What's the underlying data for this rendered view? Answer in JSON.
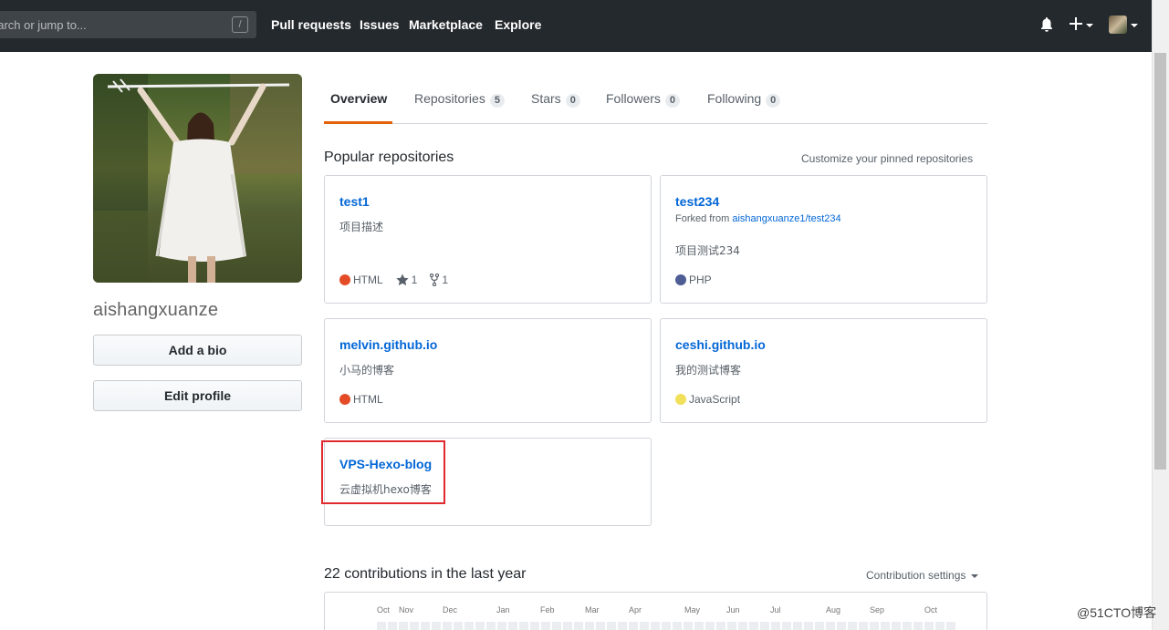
{
  "header": {
    "search_placeholder": "earch or jump to...",
    "slash_key": "/",
    "nav": [
      "Pull requests",
      "Issues",
      "Marketplace",
      "Explore"
    ]
  },
  "profile": {
    "username": "aishangxuanze",
    "add_bio_label": "Add a bio",
    "edit_profile_label": "Edit profile"
  },
  "tabs": [
    {
      "label": "Overview",
      "count": ""
    },
    {
      "label": "Repositories",
      "count": "5"
    },
    {
      "label": "Stars",
      "count": "0"
    },
    {
      "label": "Followers",
      "count": "0"
    },
    {
      "label": "Following",
      "count": "0"
    }
  ],
  "popular": {
    "title": "Popular repositories",
    "customize_label": "Customize your pinned repositories"
  },
  "repos": [
    {
      "name": "test1",
      "desc": "项目描述",
      "language": "HTML",
      "lang_color": "#e34c26",
      "stars": "1",
      "forks": "1"
    },
    {
      "name": "test234",
      "forked_from_label": "Forked from",
      "forked_from": "aishangxuanze1/test234",
      "desc": "项目测试234",
      "language": "PHP",
      "lang_color": "#4F5D95"
    },
    {
      "name": "melvin.github.io",
      "desc": "小马的博客",
      "language": "HTML",
      "lang_color": "#e34c26"
    },
    {
      "name": "ceshi.github.io",
      "desc": "我的测试博客",
      "language": "JavaScript",
      "lang_color": "#f1e05a"
    },
    {
      "name": "VPS-Hexo-blog",
      "desc": "云虚拟机hexo博客"
    }
  ],
  "contributions": {
    "title": "22 contributions in the last year",
    "settings_label": "Contribution settings",
    "months": [
      "Oct",
      "Nov",
      "Dec",
      "Jan",
      "Feb",
      "Mar",
      "Apr",
      "May",
      "Jun",
      "Jul",
      "Aug",
      "Sep",
      "Oct"
    ]
  },
  "watermark": "@51CTO博客",
  "colors": {
    "header_bg": "#24292e",
    "link": "#0366d6",
    "tab_accent": "#e36209",
    "highlight": "#e0292c"
  }
}
